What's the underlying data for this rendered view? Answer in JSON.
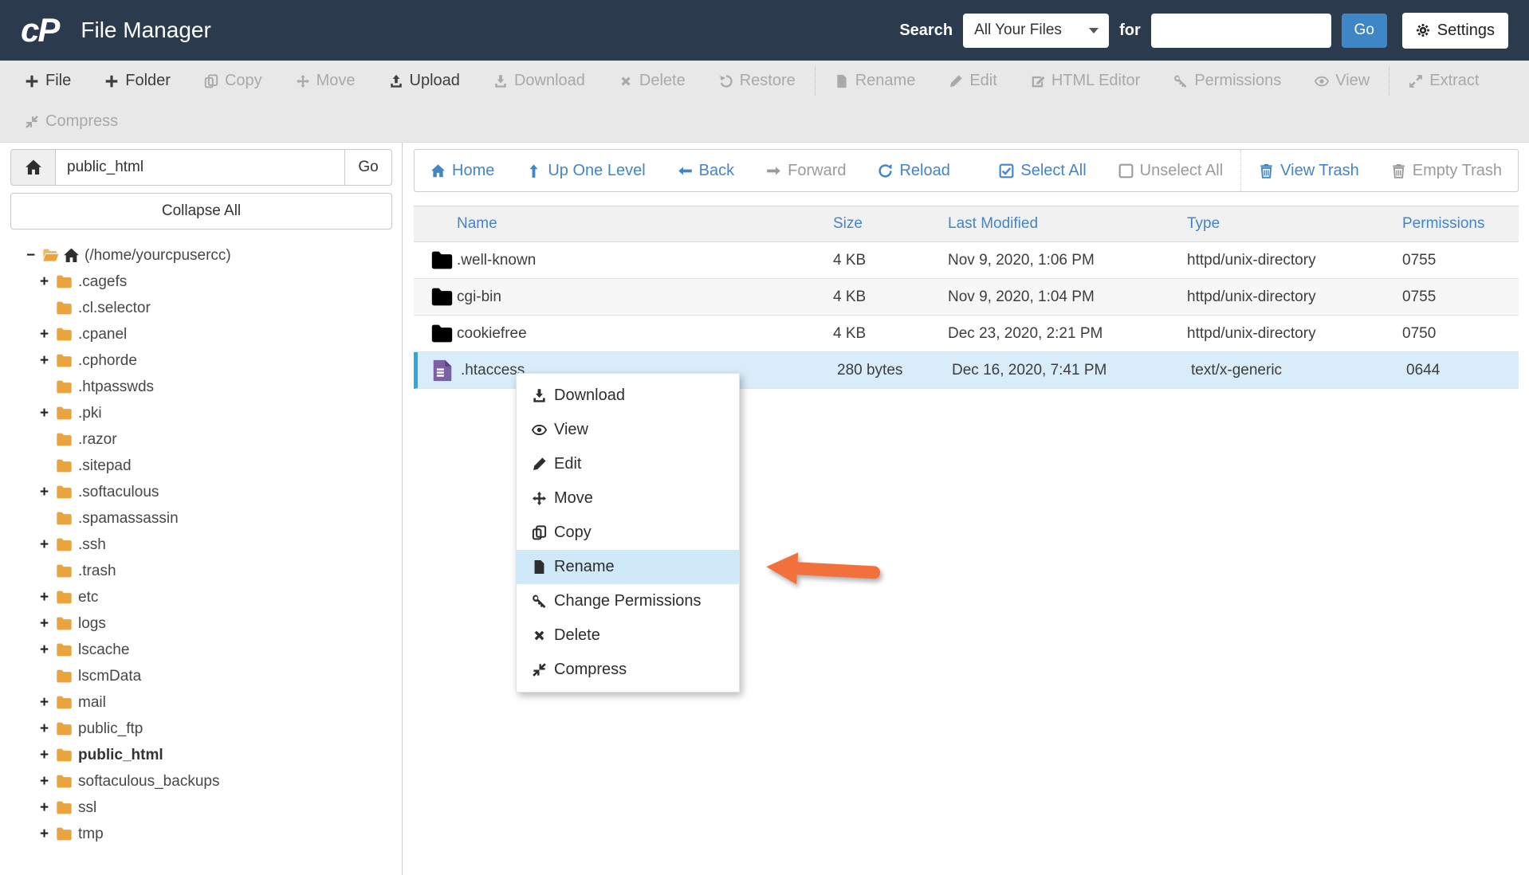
{
  "header": {
    "logo": "cP",
    "title": "File Manager",
    "search_label": "Search",
    "search_scope": "All Your Files",
    "for_label": "for",
    "search_value": "",
    "go_label": "Go",
    "settings_label": "Settings"
  },
  "toolbar": {
    "items": [
      {
        "label": "File",
        "enabled": true
      },
      {
        "label": "Folder",
        "enabled": true
      },
      {
        "label": "Copy",
        "enabled": false
      },
      {
        "label": "Move",
        "enabled": false
      },
      {
        "label": "Upload",
        "enabled": true
      },
      {
        "label": "Download",
        "enabled": false
      },
      {
        "label": "Delete",
        "enabled": false
      },
      {
        "label": "Restore",
        "enabled": false
      },
      {
        "label": "Rename",
        "enabled": false
      },
      {
        "label": "Edit",
        "enabled": false
      },
      {
        "label": "HTML Editor",
        "enabled": false
      },
      {
        "label": "Permissions",
        "enabled": false
      },
      {
        "label": "View",
        "enabled": false
      },
      {
        "label": "Extract",
        "enabled": false
      },
      {
        "label": "Compress",
        "enabled": false
      }
    ]
  },
  "sidebar": {
    "path_value": "public_html",
    "go_label": "Go",
    "collapse_all_label": "Collapse All",
    "tree": [
      {
        "expander": "−",
        "label": "(/home/yourcpusercc)"
      },
      {
        "expander": "+",
        "label": ".cagefs"
      },
      {
        "expander": "",
        "label": ".cl.selector"
      },
      {
        "expander": "+",
        "label": ".cpanel"
      },
      {
        "expander": "+",
        "label": ".cphorde"
      },
      {
        "expander": "",
        "label": ".htpasswds"
      },
      {
        "expander": "+",
        "label": ".pki"
      },
      {
        "expander": "",
        "label": ".razor"
      },
      {
        "expander": "",
        "label": ".sitepad"
      },
      {
        "expander": "+",
        "label": ".softaculous"
      },
      {
        "expander": "",
        "label": ".spamassassin"
      },
      {
        "expander": "+",
        "label": ".ssh"
      },
      {
        "expander": "",
        "label": ".trash"
      },
      {
        "expander": "+",
        "label": "etc"
      },
      {
        "expander": "+",
        "label": "logs"
      },
      {
        "expander": "+",
        "label": "lscache"
      },
      {
        "expander": "",
        "label": "lscmData"
      },
      {
        "expander": "+",
        "label": "mail"
      },
      {
        "expander": "+",
        "label": "public_ftp"
      },
      {
        "expander": "+",
        "label": "public_html"
      },
      {
        "expander": "+",
        "label": "softaculous_backups"
      },
      {
        "expander": "+",
        "label": "ssl"
      },
      {
        "expander": "+",
        "label": "tmp"
      }
    ]
  },
  "filebar": {
    "home": "Home",
    "up_one_level": "Up One Level",
    "back": "Back",
    "forward": "Forward",
    "reload": "Reload",
    "select_all": "Select All",
    "unselect_all": "Unselect All",
    "view_trash": "View Trash",
    "empty_trash": "Empty Trash"
  },
  "table": {
    "columns": [
      "Name",
      "Size",
      "Last Modified",
      "Type",
      "Permissions"
    ],
    "rows": [
      {
        "name": ".well-known",
        "size": "4 KB",
        "modified": "Nov 9, 2020, 1:06 PM",
        "type": "httpd/unix-directory",
        "permissions": "0755",
        "icon": "folder-icon",
        "selected": false
      },
      {
        "name": "cgi-bin",
        "size": "4 KB",
        "modified": "Nov 9, 2020, 1:04 PM",
        "type": "httpd/unix-directory",
        "permissions": "0755",
        "icon": "folder-icon",
        "selected": false
      },
      {
        "name": "cookiefree",
        "size": "4 KB",
        "modified": "Dec 23, 2020, 2:21 PM",
        "type": "httpd/unix-directory",
        "permissions": "0750",
        "icon": "folder-icon",
        "selected": false
      },
      {
        "name": ".htaccess",
        "size": "280 bytes",
        "modified": "Dec 16, 2020, 7:41 PM",
        "type": "text/x-generic",
        "permissions": "0644",
        "icon": "file-icon",
        "selected": true
      }
    ]
  },
  "context_menu": {
    "items": [
      {
        "label": "Download",
        "icon": "download-icon",
        "highlighted": false
      },
      {
        "label": "View",
        "icon": "eye-icon",
        "highlighted": false
      },
      {
        "label": "Edit",
        "icon": "pencil-icon",
        "highlighted": false
      },
      {
        "label": "Move",
        "icon": "move-icon",
        "highlighted": false
      },
      {
        "label": "Copy",
        "icon": "copy-icon",
        "highlighted": false
      },
      {
        "label": "Rename",
        "icon": "file-icon",
        "highlighted": true
      },
      {
        "label": "Change Permissions",
        "icon": "key-icon",
        "highlighted": false
      },
      {
        "label": "Delete",
        "icon": "x-icon",
        "highlighted": false
      },
      {
        "label": "Compress",
        "icon": "compress-icon",
        "highlighted": false
      }
    ]
  },
  "colors": {
    "header_bg": "#2b3a4c",
    "toolbar_bg": "#e8e8e8",
    "link_blue": "#4285c8",
    "go_button_blue": "#3e86c6",
    "selected_row_bg": "#d8ecf9",
    "selected_row_border": "#29a8e2",
    "folder_icon_orange": "#e9a43e",
    "file_icon_purple": "#7d5fa5",
    "arrow_orange": "#f1703c",
    "disabled_gray": "#a9a9a9"
  }
}
